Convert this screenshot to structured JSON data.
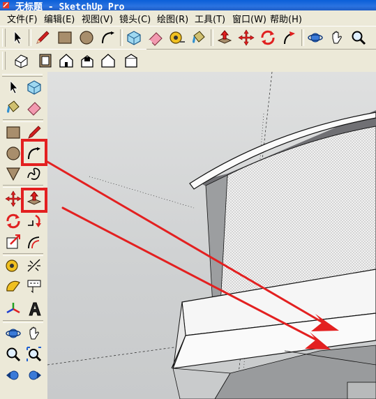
{
  "window": {
    "title": "无标题 - SketchUp Pro"
  },
  "menu": [
    "文件(F)",
    "编辑(E)",
    "视图(V)",
    "镜头(C)",
    "绘图(R)",
    "工具(T)",
    "窗口(W)",
    "帮助(H)"
  ],
  "toolbar_main": [
    {
      "name": "select-icon"
    },
    {
      "name": "pencil-icon"
    },
    {
      "name": "rectangle-icon"
    },
    {
      "name": "circle-icon"
    },
    {
      "name": "arc-icon"
    },
    {
      "name": "make-component-icon"
    },
    {
      "name": "eraser-icon"
    },
    {
      "name": "tape-measure-icon"
    },
    {
      "name": "paint-bucket-icon"
    },
    {
      "name": "push-pull-icon"
    },
    {
      "name": "move-icon"
    },
    {
      "name": "rotate-icon"
    },
    {
      "name": "follow-me-icon"
    },
    {
      "name": "orbit-icon"
    },
    {
      "name": "pan-icon"
    },
    {
      "name": "zoom-icon"
    },
    {
      "name": "zoom-extents-icon"
    }
  ],
  "toolbar_views": [
    {
      "name": "iso-view-icon"
    },
    {
      "name": "top-view-icon"
    },
    {
      "name": "front-view-icon"
    },
    {
      "name": "right-view-icon"
    },
    {
      "name": "back-view-icon"
    },
    {
      "name": "left-view-icon"
    }
  ],
  "left_toolbar": [
    [
      "select-icon",
      "make-component-icon"
    ],
    [
      "paint-bucket-icon",
      "eraser-icon"
    ],
    [
      "rectangle-icon",
      "line-icon"
    ],
    [
      "circle-icon",
      "arc-icon"
    ],
    [
      "polygon-icon",
      "freehand-icon"
    ],
    [
      "move-icon",
      "push-pull-icon"
    ],
    [
      "rotate-icon",
      "follow-me-icon"
    ],
    [
      "scale-icon",
      "offset-icon"
    ],
    [
      "tape-measure-icon",
      "dimension-icon"
    ],
    [
      "protractor-icon",
      "text-icon"
    ],
    [
      "axes-icon",
      "3d-text-icon"
    ],
    [
      "orbit-icon",
      "pan-icon"
    ],
    [
      "zoom-icon",
      "zoom-window-icon"
    ],
    [
      "previous-view-icon",
      "next-view-icon"
    ]
  ],
  "annotations": {
    "highlight_color": "#e32020",
    "arrow_color": "#e32020",
    "highlighted_tools": [
      "arc-icon",
      "push-pull-icon"
    ]
  },
  "colors": {
    "titlebar": "#0a5fd8",
    "chrome": "#ece9d8",
    "viewport_bg": "#d6d8d8"
  }
}
